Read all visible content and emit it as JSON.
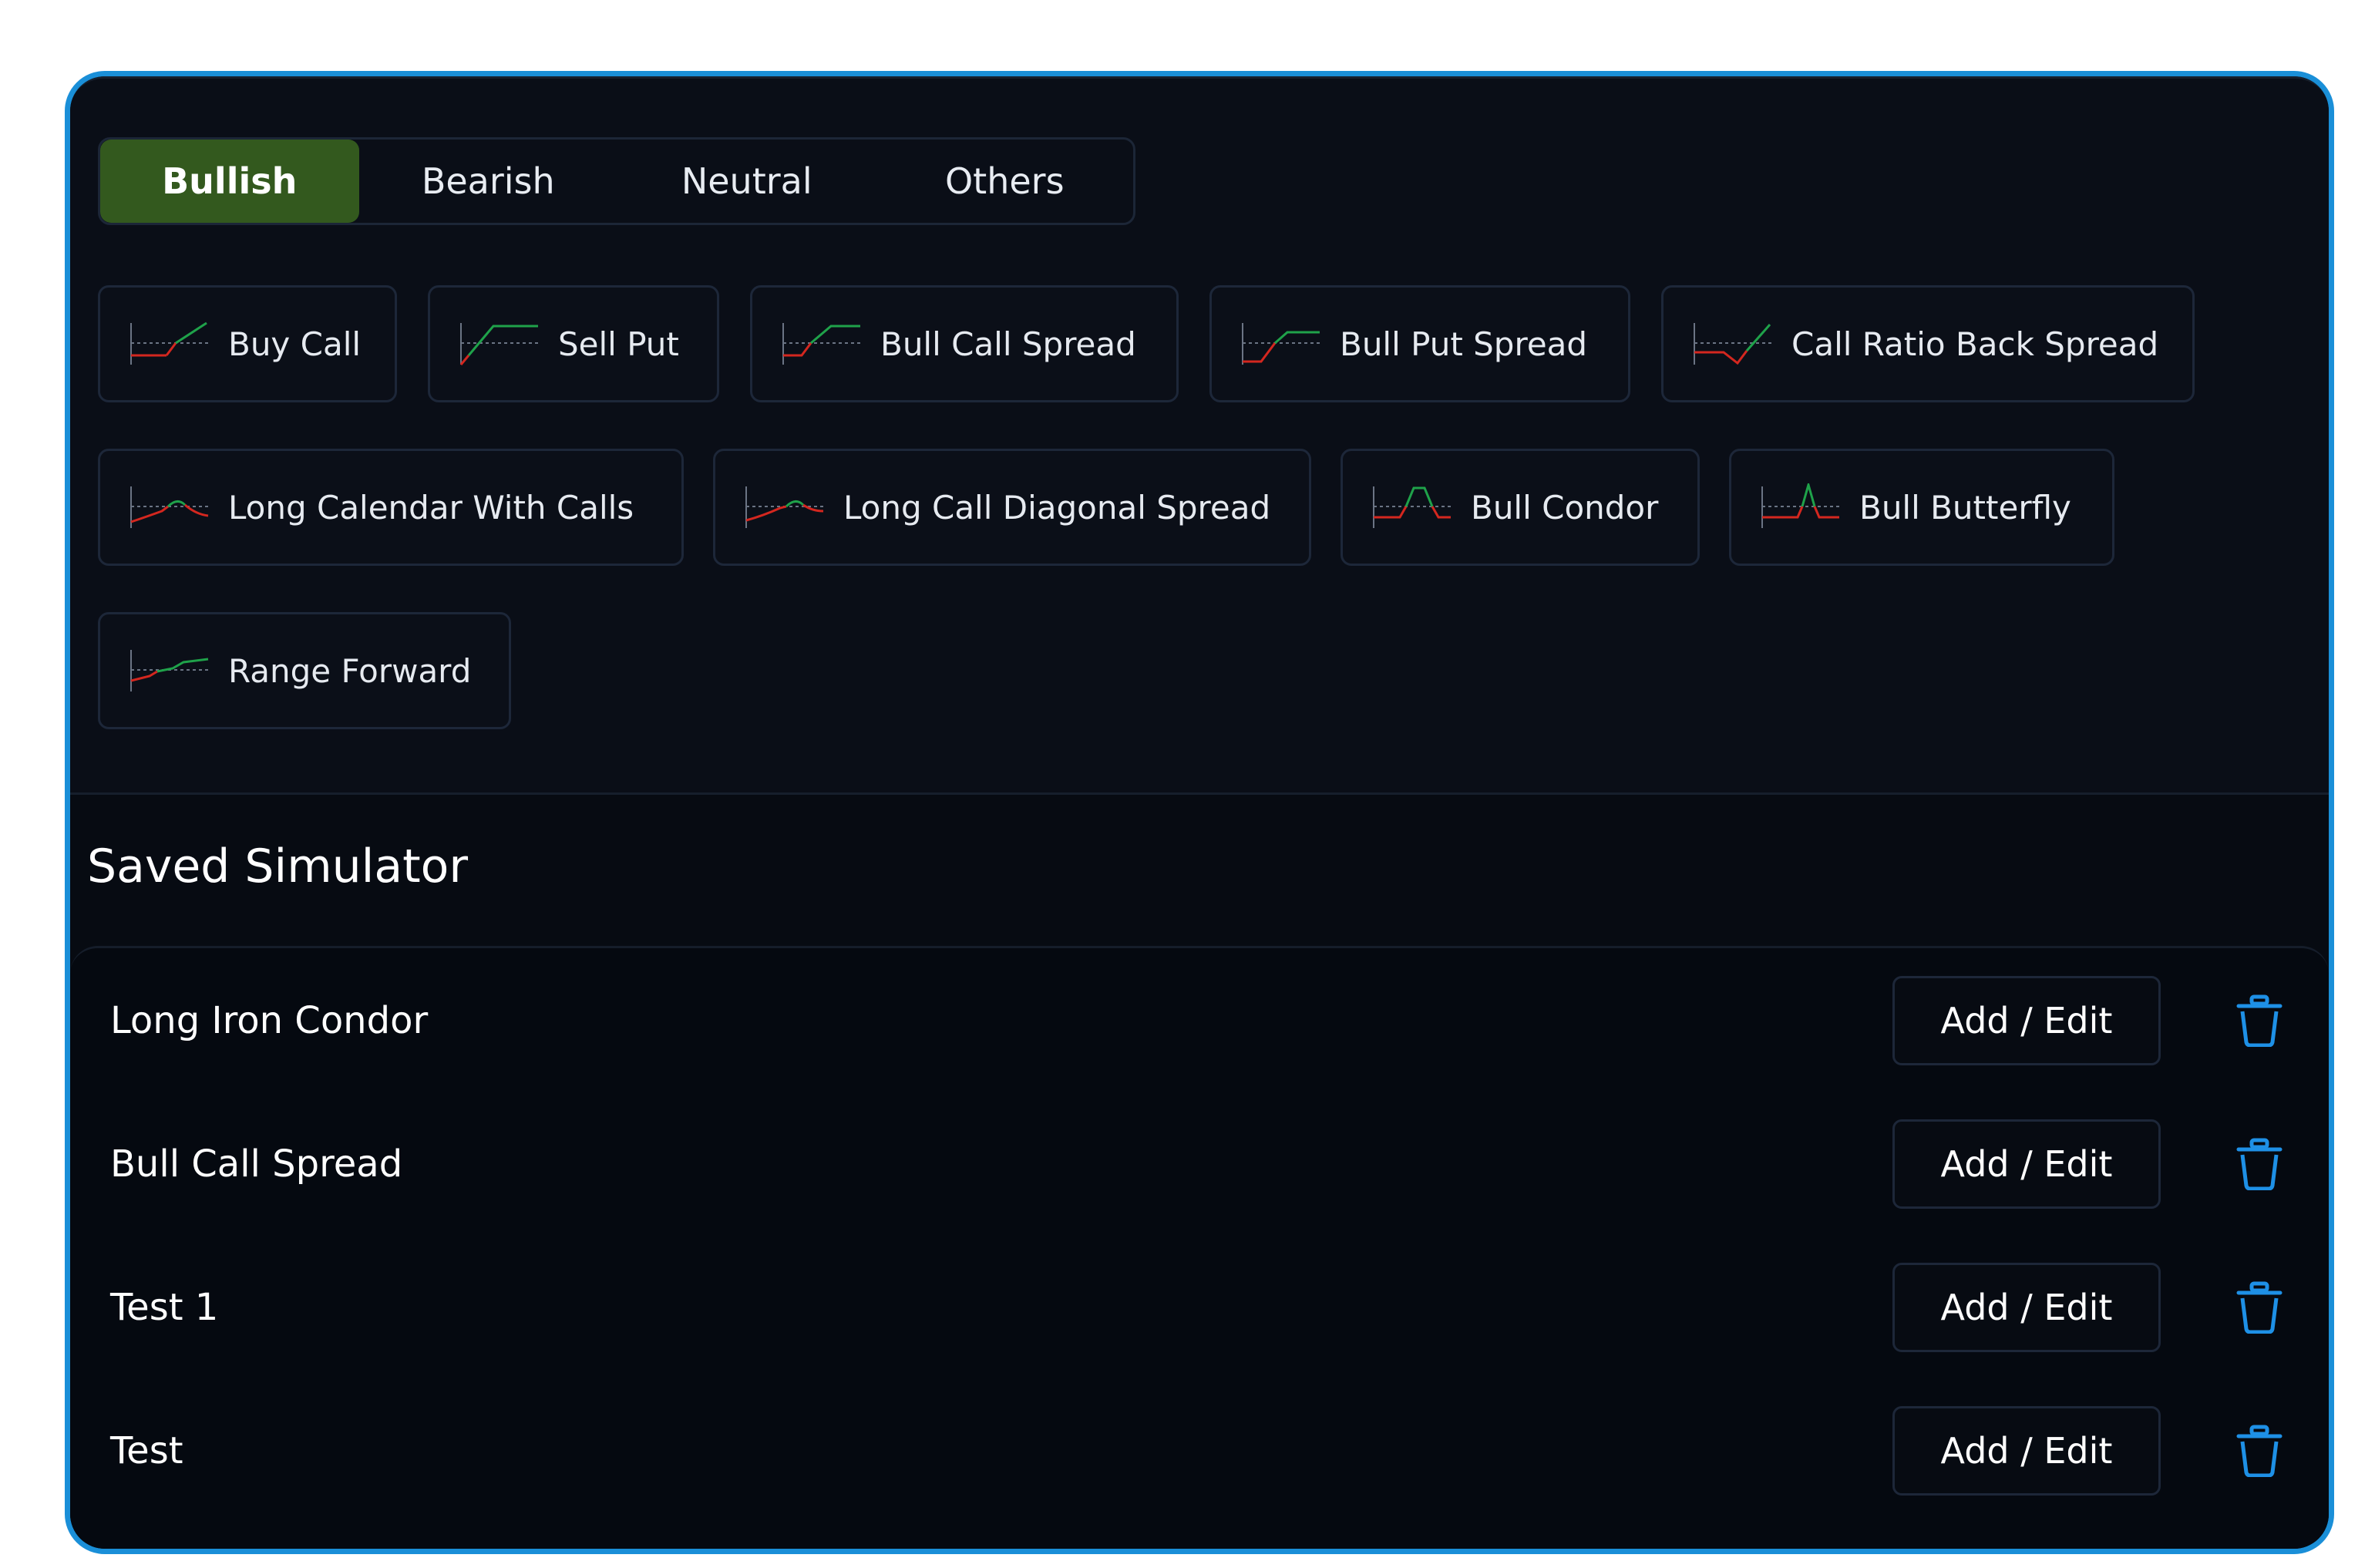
{
  "tabs": [
    {
      "label": "Bullish",
      "active": true
    },
    {
      "label": "Bearish",
      "active": false
    },
    {
      "label": "Neutral",
      "active": false
    },
    {
      "label": "Others",
      "active": false
    }
  ],
  "strategies": [
    {
      "label": "Buy Call",
      "icon": "buy-call-payoff-icon"
    },
    {
      "label": "Sell Put",
      "icon": "sell-put-payoff-icon"
    },
    {
      "label": "Bull Call Spread",
      "icon": "bull-call-spread-payoff-icon"
    },
    {
      "label": "Bull Put Spread",
      "icon": "bull-put-spread-payoff-icon"
    },
    {
      "label": "Call Ratio Back Spread",
      "icon": "call-ratio-back-spread-payoff-icon"
    },
    {
      "label": "Long Calendar With Calls",
      "icon": "long-calendar-payoff-icon"
    },
    {
      "label": "Long Call Diagonal Spread",
      "icon": "long-call-diagonal-payoff-icon"
    },
    {
      "label": "Bull Condor",
      "icon": "bull-condor-payoff-icon"
    },
    {
      "label": "Bull Butterfly",
      "icon": "bull-butterfly-payoff-icon"
    },
    {
      "label": "Range Forward",
      "icon": "range-forward-payoff-icon"
    }
  ],
  "saved": {
    "title": "Saved Simulator",
    "edit_label": "Add / Edit",
    "items": [
      {
        "name": "Long Iron Condor"
      },
      {
        "name": "Bull Call Spread"
      },
      {
        "name": "Test 1"
      },
      {
        "name": "Test"
      }
    ]
  },
  "colors": {
    "accent_border": "#1a8fd8",
    "active_tab": "#33591e",
    "profit": "#1fa24a",
    "loss": "#d4271f",
    "trash": "#1e90e6"
  }
}
